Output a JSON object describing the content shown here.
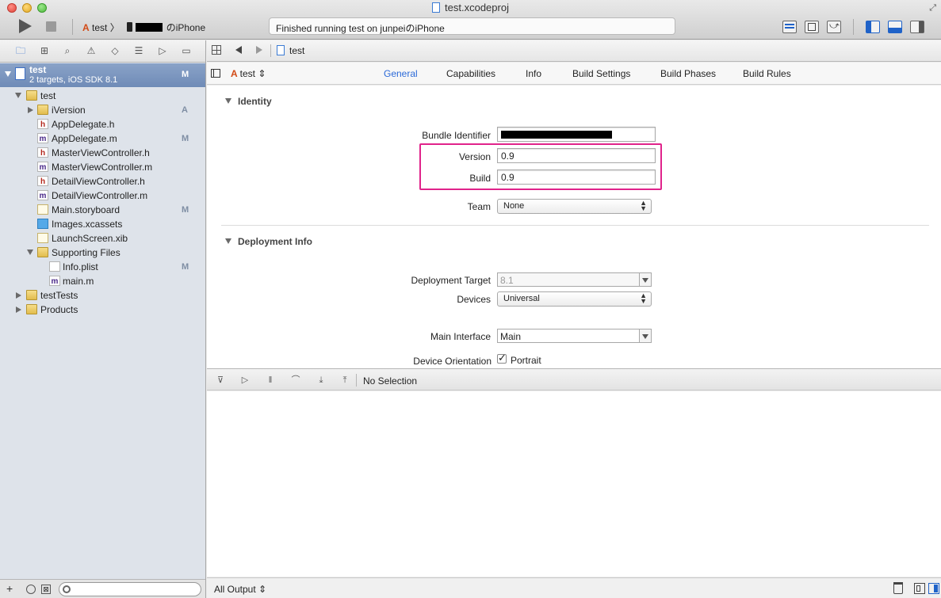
{
  "window": {
    "title": "test.xcodeproj",
    "status": "Finished running test on junpeiのiPhone"
  },
  "scheme": {
    "target": "test",
    "separator": "〉",
    "device_suffix": "のiPhone"
  },
  "navigator": {
    "project": {
      "name": "test",
      "subtitle": "2 targets, iOS SDK 8.1",
      "badge": "M"
    },
    "items": [
      {
        "label": "test",
        "type": "folder",
        "badge": ""
      },
      {
        "label": "iVersion",
        "type": "folder",
        "badge": "A"
      },
      {
        "label": "AppDelegate.h",
        "type": "h",
        "badge": ""
      },
      {
        "label": "AppDelegate.m",
        "type": "m",
        "badge": "M"
      },
      {
        "label": "MasterViewController.h",
        "type": "h",
        "badge": ""
      },
      {
        "label": "MasterViewController.m",
        "type": "m",
        "badge": ""
      },
      {
        "label": "DetailViewController.h",
        "type": "h",
        "badge": ""
      },
      {
        "label": "DetailViewController.m",
        "type": "m",
        "badge": ""
      },
      {
        "label": "Main.storyboard",
        "type": "storyboard",
        "badge": "M"
      },
      {
        "label": "Images.xcassets",
        "type": "xcassets",
        "badge": ""
      },
      {
        "label": "LaunchScreen.xib",
        "type": "xib",
        "badge": ""
      },
      {
        "label": "Supporting Files",
        "type": "folder",
        "badge": ""
      },
      {
        "label": "Info.plist",
        "type": "plist",
        "badge": "M"
      },
      {
        "label": "main.m",
        "type": "m",
        "badge": ""
      },
      {
        "label": "testTests",
        "type": "folder",
        "badge": ""
      },
      {
        "label": "Products",
        "type": "folder",
        "badge": ""
      }
    ],
    "filter_add": "+"
  },
  "jumpbar": {
    "file": "test"
  },
  "editor": {
    "target": "test",
    "tabs": [
      "General",
      "Capabilities",
      "Info",
      "Build Settings",
      "Build Phases",
      "Build Rules"
    ],
    "identity": {
      "heading": "Identity",
      "bundle_identifier_label": "Bundle Identifier",
      "version_label": "Version",
      "version_value": "0.9",
      "build_label": "Build",
      "build_value": "0.9",
      "team_label": "Team",
      "team_value": "None"
    },
    "deployment": {
      "heading": "Deployment Info",
      "target_label": "Deployment Target",
      "target_value": "8.1",
      "devices_label": "Devices",
      "devices_value": "Universal",
      "main_interface_label": "Main Interface",
      "main_interface_value": "Main",
      "orientation_label": "Device Orientation",
      "portrait_label": "Portrait",
      "portrait_checked": true
    },
    "highlight_color": "#e0238b"
  },
  "debug": {
    "selection": "No Selection",
    "output": "All Output"
  },
  "colors": {
    "accent": "#2c6ad8",
    "selection": "#7a95bf"
  }
}
